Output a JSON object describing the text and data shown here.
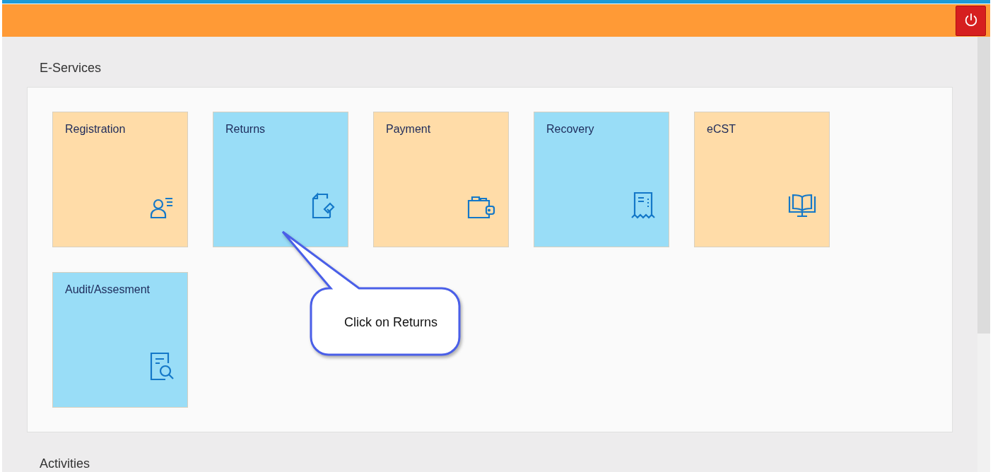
{
  "sections": [
    {
      "title": "E-Services",
      "tiles": [
        {
          "label": "Registration",
          "kind": "person",
          "color": "#ffdca8"
        },
        {
          "label": "Returns",
          "kind": "document",
          "color": "#99ddf7"
        },
        {
          "label": "Payment",
          "kind": "wallet",
          "color": "#ffdca8"
        },
        {
          "label": "Recovery",
          "kind": "receipt",
          "color": "#99ddf7"
        },
        {
          "label": "eCST",
          "kind": "book",
          "color": "#ffdca8"
        },
        {
          "label": "Audit/Assesment",
          "kind": "search-doc",
          "color": "#99ddf7"
        }
      ]
    },
    {
      "title": "Activities"
    }
  ],
  "callout": {
    "text": "Click on Returns"
  }
}
